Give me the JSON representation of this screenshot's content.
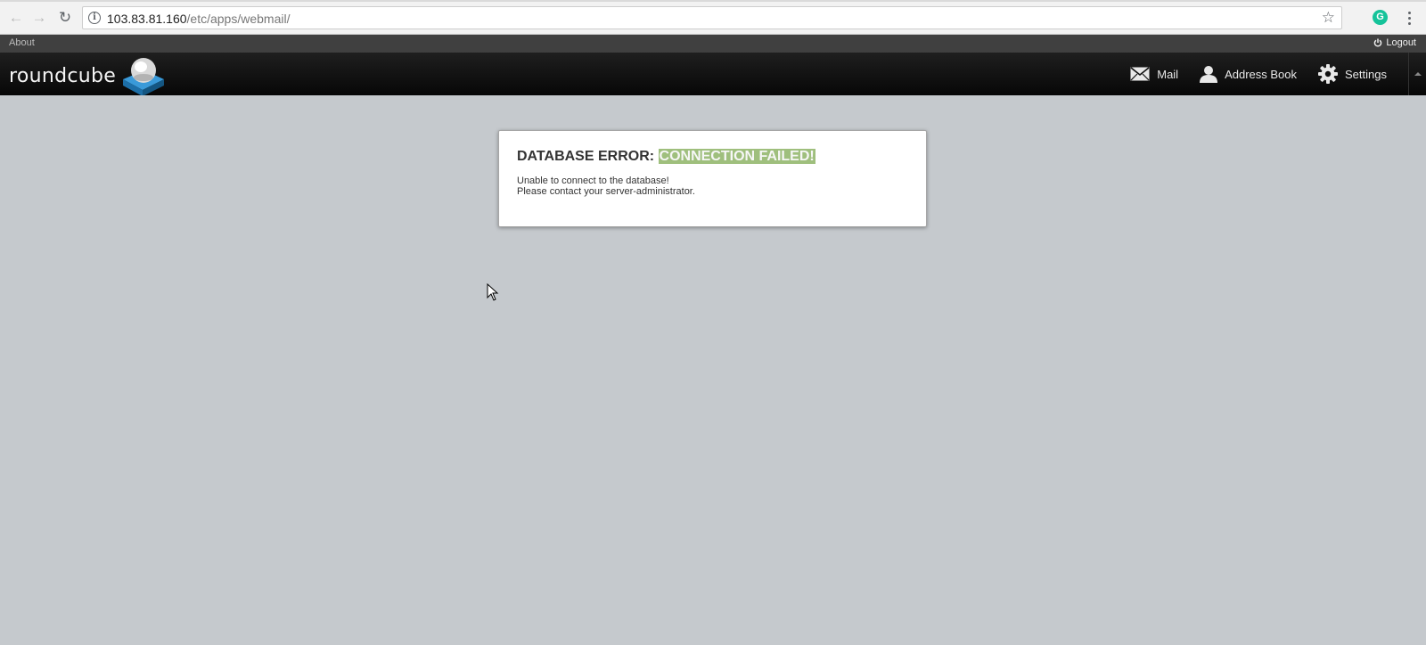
{
  "browser": {
    "url_host": "103.83.81.160",
    "url_path": "/etc/apps/webmail/",
    "back_icon": "back-arrow-icon",
    "forward_icon": "forward-arrow-icon",
    "reload_icon": "reload-icon",
    "bookmark_icon": "star-icon",
    "extension_letter": "G"
  },
  "topline": {
    "about_label": "About",
    "logout_label": "Logout"
  },
  "header": {
    "logo_text": "roundcube",
    "tasks": [
      {
        "label": "Mail",
        "icon": "mail-icon"
      },
      {
        "label": "Address Book",
        "icon": "person-icon"
      },
      {
        "label": "Settings",
        "icon": "gear-icon"
      }
    ]
  },
  "error": {
    "title_prefix": "DATABASE ERROR: ",
    "title_highlight": "CONNECTION FAILED!",
    "line1": "Unable to connect to the database!",
    "line2": "Please contact your server-administrator."
  },
  "colors": {
    "highlight": "#9fbf7d",
    "header_bg": "#0a0a0a",
    "page_bg": "#c5c9cd"
  }
}
